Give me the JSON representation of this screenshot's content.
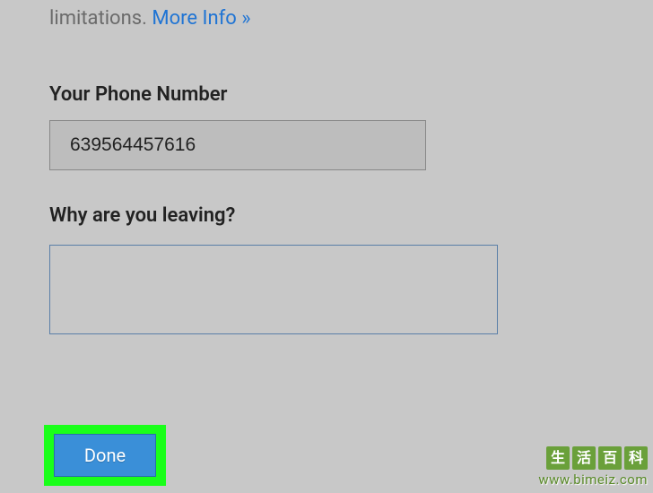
{
  "intro": {
    "text_fragment": "limitations. ",
    "link_text": "More Info »"
  },
  "phone": {
    "label": "Your Phone Number",
    "value": "639564457616"
  },
  "reason": {
    "label": "Why are you leaving?",
    "value": ""
  },
  "actions": {
    "done_label": "Done"
  },
  "watermark": {
    "chars": [
      "生",
      "活",
      "百",
      "科"
    ],
    "url": "www.bimeiz.com"
  }
}
